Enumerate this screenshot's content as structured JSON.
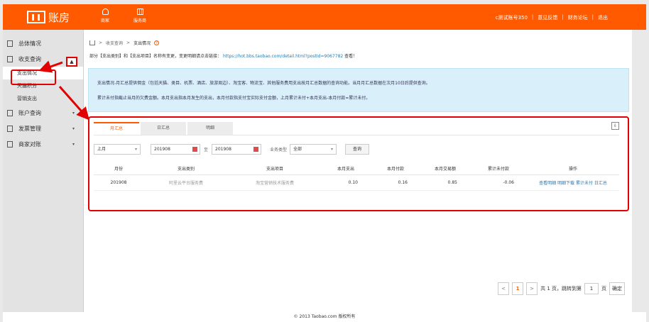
{
  "app": {
    "logo_text": "账房"
  },
  "topnav": [
    {
      "label": "商家",
      "icon": "user-icon"
    },
    {
      "label": "服务商",
      "icon": "grid-icon"
    }
  ],
  "toplinks": [
    "c测试账号350",
    "意见反馈",
    "财务论坛",
    "退出"
  ],
  "sidebar": {
    "items": [
      {
        "label": "总体情况",
        "icon": "overview-icon"
      },
      {
        "label": "收支查询",
        "icon": "doc-icon",
        "expanded": true
      },
      {
        "label": "账户查询",
        "icon": "account-icon"
      },
      {
        "label": "发票管理",
        "icon": "invoice-icon"
      },
      {
        "label": "商家对账",
        "icon": "reconcile-icon"
      }
    ],
    "subitems": [
      "支出情况",
      "天猫积分",
      "营销支出"
    ]
  },
  "breadcrumb": {
    "home": "home-icon",
    "level1": "收支查询",
    "current": "支出情况"
  },
  "notice": {
    "text": "部分【支出类别】和【支出项目】名称有变更，变更明细请点击链接：",
    "link": "https://hot.bbs.taobao.com/detail.html?postId=9067782",
    "suffix": "查看！"
  },
  "info": {
    "line1": "支出情况-月汇总提供佣金（包括天猫、类目、机票、酒店、旅游周边）、淘宝客、物流宝、其他服务费用支出按月汇总数据的查询功能。当月月汇总数据在次月10日后提供查询。",
    "line2": "累计未付指截止当月的欠费金额。本月支出指本月发生的支出，本月付款指支付宝实际支付金额，上月累计未付+本月支出-本月付款=累计未付。"
  },
  "tabs": [
    "月汇总",
    "日汇总",
    "明细"
  ],
  "filters": {
    "period": "上月",
    "date_from": "201908",
    "date_to_label": "至",
    "date_to": "201908",
    "biz_label": "业务类型",
    "biz_value": "全部",
    "query": "查询"
  },
  "table": {
    "headers": [
      "月份",
      "支出类别",
      "支出项目",
      "本月支出",
      "本月付款",
      "本月交易额",
      "累计未付款",
      "操作"
    ],
    "rows": [
      {
        "month": "201908",
        "category": "阿里云平台服务费",
        "item": "淘宝营销技术服务费",
        "spend": "0.10",
        "paid": "0.16",
        "trade": "0.85",
        "unpaid": "-0.06",
        "ops": "查看明细 明细下载 累计未付 日汇总"
      }
    ]
  },
  "pager": {
    "prev": "<",
    "page": "1",
    "next": ">",
    "total": "共 1 页，跳转到第",
    "input": "1",
    "unit": "页",
    "confirm": "确定"
  },
  "footer": "© 2013 Taobao.com 版权所有",
  "colors": {
    "accent": "#ff5a00",
    "highlight": "#e30000",
    "info_bg": "#d9f0fb"
  }
}
